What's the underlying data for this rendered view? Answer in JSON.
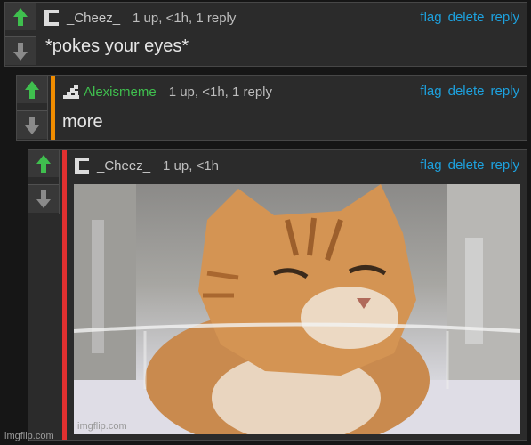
{
  "comments": [
    {
      "username": "_Cheez_",
      "stats": "1 up, <1h, 1 reply",
      "text": "*pokes your eyes*",
      "actions": {
        "flag": "flag",
        "delete": "delete",
        "reply": "reply"
      }
    },
    {
      "username": "Alexismeme",
      "stats": "1 up, <1h, 1 reply",
      "text": "more",
      "actions": {
        "flag": "flag",
        "delete": "delete",
        "reply": "reply"
      },
      "depth_color": "#f08c00"
    },
    {
      "username": "_Cheez_",
      "stats": "1 up, <1h",
      "actions": {
        "flag": "flag",
        "delete": "delete",
        "reply": "reply"
      },
      "depth_color": "#e03030",
      "image_watermark": "imgflip.com"
    }
  ],
  "page_watermark": "imgflip.com",
  "colors": {
    "upvote": "#3fbf4e",
    "link": "#1da1de",
    "username_green": "#3fbf4e"
  }
}
